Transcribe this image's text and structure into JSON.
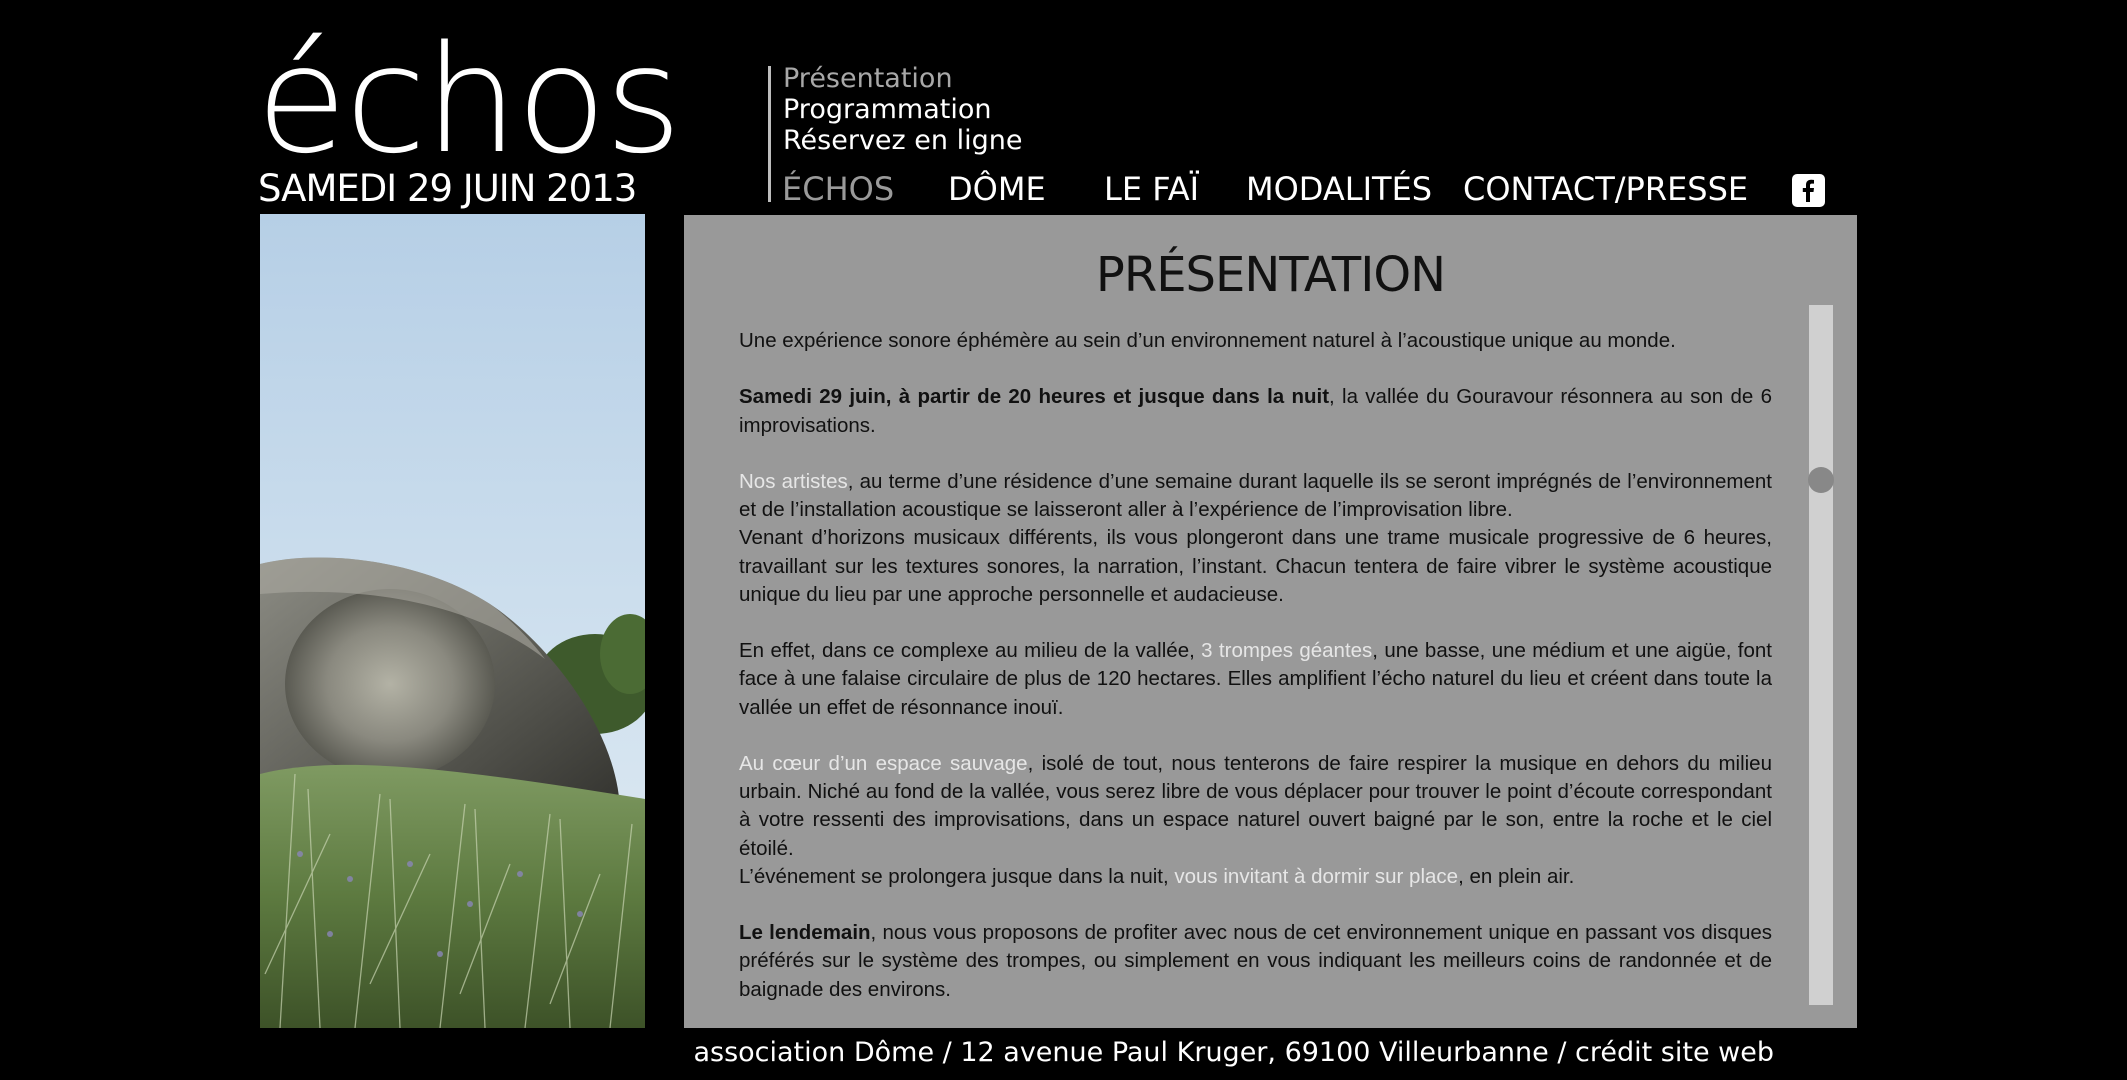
{
  "header": {
    "logo": "échos",
    "date": "SAMEDI 29 JUIN 2013"
  },
  "subnav": {
    "items": [
      {
        "label": "Présentation",
        "color": "#a8a8a8"
      },
      {
        "label": "Programmation",
        "color": "#ffffff"
      },
      {
        "label": "Réservez en ligne",
        "color": "#ffffff"
      }
    ]
  },
  "mainnav": {
    "items": [
      {
        "label": "ÉCHOS",
        "active": true
      },
      {
        "label": "DÔME"
      },
      {
        "label": "LE FAÏ"
      },
      {
        "label": "MODALITÉS"
      },
      {
        "label": "CONTACT/PRESSE"
      }
    ],
    "facebook_icon": "facebook-icon",
    "active_color": "#9a9a9a",
    "color": "#ffffff"
  },
  "content": {
    "title": "PRÉSENTATION",
    "p1": "Une expérience sonore éphémère au sein d’un environnement naturel à l’acoustique unique au monde.",
    "p2_bold": "Samedi 29 juin, à partir de 20 heures et jusque dans la nuit",
    "p2_rest": ", la vallée du Gouravour résonnera au son de 6 improvisations.",
    "p3_link": "Nos artistes",
    "p3_rest": ", au terme d’une résidence d’une semaine durant laquelle ils se seront imprégnés de l’environnement et de l’installation acoustique se laisseront aller à l’expérience de l’improvisation libre.",
    "p3_second": "Venant d’horizons musicaux différents, ils vous plongeront dans une trame musicale progressive de 6 heures, travaillant sur les textures sonores, la narration, l’instant. Chacun tentera de faire vibrer le système acoustique unique du lieu par une approche personnelle et audacieuse.",
    "p4_start": "En effet, dans ce complexe au milieu de la vallée, ",
    "p4_link": "3 trompes géantes",
    "p4_rest": ", une basse, une médium et une aigüe, font face à une falaise circulaire de plus de 120 hectares. Elles amplifient l’écho naturel du lieu et créent dans toute la vallée un effet de résonnance inouï.",
    "p5_link": "Au cœur d’un espace sauvage",
    "p5_rest": ", isolé de tout, nous tenterons de faire respirer la musique en dehors du milieu urbain. Niché au fond de la vallée, vous serez libre de vous déplacer pour trouver le point d’écoute correspondant à votre ressenti des improvisations, dans un espace naturel ouvert baigné par le son, entre la roche et le ciel étoilé.",
    "p5_second_start": "L’événement se prolongera jusque dans la nuit, ",
    "p5_second_link": "vous invitant à dormir sur place",
    "p5_second_end": ", en plein air.",
    "p6_bold": "Le lendemain",
    "p6_rest": ", nous vous proposons de profiter avec nous de cet environnement unique en passant vos disques préférés sur le système des trompes, ou simplement en vous indiquant les meilleurs coins de randonnée et de baignade des environs."
  },
  "footer": {
    "text": "association Dôme / 12 avenue Paul Kruger, 69100 Villeurbanne / ",
    "credit_link": "crédit site web"
  },
  "colors": {
    "background": "#000000",
    "panel": "#999999",
    "link": "#e6e6e6"
  }
}
